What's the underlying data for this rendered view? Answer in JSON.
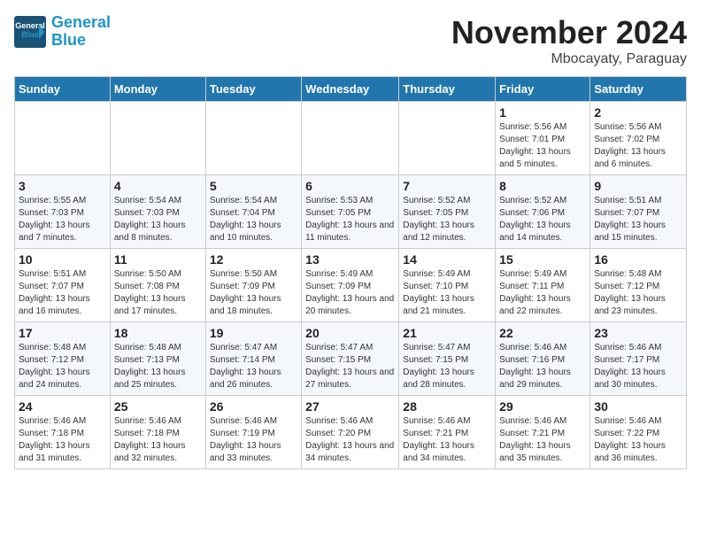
{
  "header": {
    "logo_line1": "General",
    "logo_line2": "Blue",
    "title": "November 2024",
    "subtitle": "Mbocayaty, Paraguay"
  },
  "days_of_week": [
    "Sunday",
    "Monday",
    "Tuesday",
    "Wednesday",
    "Thursday",
    "Friday",
    "Saturday"
  ],
  "weeks": [
    [
      {
        "day": "",
        "detail": ""
      },
      {
        "day": "",
        "detail": ""
      },
      {
        "day": "",
        "detail": ""
      },
      {
        "day": "",
        "detail": ""
      },
      {
        "day": "",
        "detail": ""
      },
      {
        "day": "1",
        "detail": "Sunrise: 5:56 AM\nSunset: 7:01 PM\nDaylight: 13 hours and 5 minutes."
      },
      {
        "day": "2",
        "detail": "Sunrise: 5:56 AM\nSunset: 7:02 PM\nDaylight: 13 hours and 6 minutes."
      }
    ],
    [
      {
        "day": "3",
        "detail": "Sunrise: 5:55 AM\nSunset: 7:03 PM\nDaylight: 13 hours and 7 minutes."
      },
      {
        "day": "4",
        "detail": "Sunrise: 5:54 AM\nSunset: 7:03 PM\nDaylight: 13 hours and 8 minutes."
      },
      {
        "day": "5",
        "detail": "Sunrise: 5:54 AM\nSunset: 7:04 PM\nDaylight: 13 hours and 10 minutes."
      },
      {
        "day": "6",
        "detail": "Sunrise: 5:53 AM\nSunset: 7:05 PM\nDaylight: 13 hours and 11 minutes."
      },
      {
        "day": "7",
        "detail": "Sunrise: 5:52 AM\nSunset: 7:05 PM\nDaylight: 13 hours and 12 minutes."
      },
      {
        "day": "8",
        "detail": "Sunrise: 5:52 AM\nSunset: 7:06 PM\nDaylight: 13 hours and 14 minutes."
      },
      {
        "day": "9",
        "detail": "Sunrise: 5:51 AM\nSunset: 7:07 PM\nDaylight: 13 hours and 15 minutes."
      }
    ],
    [
      {
        "day": "10",
        "detail": "Sunrise: 5:51 AM\nSunset: 7:07 PM\nDaylight: 13 hours and 16 minutes."
      },
      {
        "day": "11",
        "detail": "Sunrise: 5:50 AM\nSunset: 7:08 PM\nDaylight: 13 hours and 17 minutes."
      },
      {
        "day": "12",
        "detail": "Sunrise: 5:50 AM\nSunset: 7:09 PM\nDaylight: 13 hours and 18 minutes."
      },
      {
        "day": "13",
        "detail": "Sunrise: 5:49 AM\nSunset: 7:09 PM\nDaylight: 13 hours and 20 minutes."
      },
      {
        "day": "14",
        "detail": "Sunrise: 5:49 AM\nSunset: 7:10 PM\nDaylight: 13 hours and 21 minutes."
      },
      {
        "day": "15",
        "detail": "Sunrise: 5:49 AM\nSunset: 7:11 PM\nDaylight: 13 hours and 22 minutes."
      },
      {
        "day": "16",
        "detail": "Sunrise: 5:48 AM\nSunset: 7:12 PM\nDaylight: 13 hours and 23 minutes."
      }
    ],
    [
      {
        "day": "17",
        "detail": "Sunrise: 5:48 AM\nSunset: 7:12 PM\nDaylight: 13 hours and 24 minutes."
      },
      {
        "day": "18",
        "detail": "Sunrise: 5:48 AM\nSunset: 7:13 PM\nDaylight: 13 hours and 25 minutes."
      },
      {
        "day": "19",
        "detail": "Sunrise: 5:47 AM\nSunset: 7:14 PM\nDaylight: 13 hours and 26 minutes."
      },
      {
        "day": "20",
        "detail": "Sunrise: 5:47 AM\nSunset: 7:15 PM\nDaylight: 13 hours and 27 minutes."
      },
      {
        "day": "21",
        "detail": "Sunrise: 5:47 AM\nSunset: 7:15 PM\nDaylight: 13 hours and 28 minutes."
      },
      {
        "day": "22",
        "detail": "Sunrise: 5:46 AM\nSunset: 7:16 PM\nDaylight: 13 hours and 29 minutes."
      },
      {
        "day": "23",
        "detail": "Sunrise: 5:46 AM\nSunset: 7:17 PM\nDaylight: 13 hours and 30 minutes."
      }
    ],
    [
      {
        "day": "24",
        "detail": "Sunrise: 5:46 AM\nSunset: 7:18 PM\nDaylight: 13 hours and 31 minutes."
      },
      {
        "day": "25",
        "detail": "Sunrise: 5:46 AM\nSunset: 7:18 PM\nDaylight: 13 hours and 32 minutes."
      },
      {
        "day": "26",
        "detail": "Sunrise: 5:46 AM\nSunset: 7:19 PM\nDaylight: 13 hours and 33 minutes."
      },
      {
        "day": "27",
        "detail": "Sunrise: 5:46 AM\nSunset: 7:20 PM\nDaylight: 13 hours and 34 minutes."
      },
      {
        "day": "28",
        "detail": "Sunrise: 5:46 AM\nSunset: 7:21 PM\nDaylight: 13 hours and 34 minutes."
      },
      {
        "day": "29",
        "detail": "Sunrise: 5:46 AM\nSunset: 7:21 PM\nDaylight: 13 hours and 35 minutes."
      },
      {
        "day": "30",
        "detail": "Sunrise: 5:46 AM\nSunset: 7:22 PM\nDaylight: 13 hours and 36 minutes."
      }
    ]
  ]
}
